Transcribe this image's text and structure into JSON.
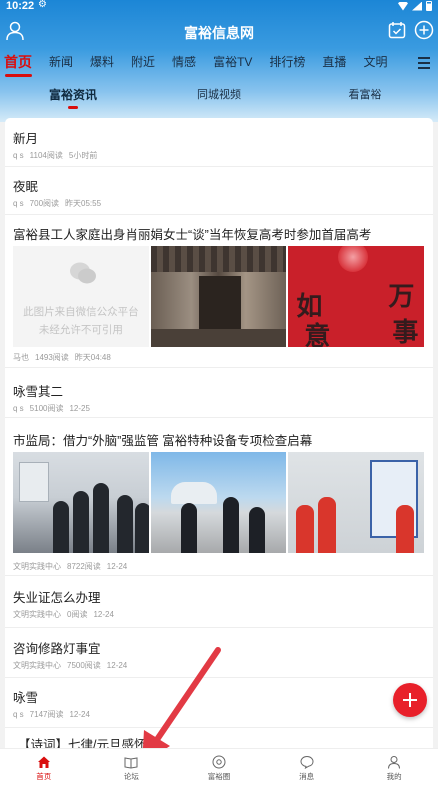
{
  "status_bar": {
    "time": "10:22"
  },
  "header": {
    "title": "富裕信息网"
  },
  "nav": {
    "tabs": [
      "首页",
      "新闻",
      "爆料",
      "附近",
      "情感",
      "富裕TV",
      "排行榜",
      "直播",
      "文明"
    ],
    "active_index": 0
  },
  "subtabs": {
    "items": [
      "富裕资讯",
      "同城视频",
      "看富裕"
    ],
    "active_index": 0
  },
  "feed": [
    {
      "title": "新月",
      "author": "q s",
      "reads": "1104阅读",
      "time": "5小时前"
    },
    {
      "title": "夜眠",
      "author": "q s",
      "reads": "700阅读",
      "time": "昨天05:55"
    },
    {
      "title": "富裕县工人家庭出身肖丽娟女士“谈”当年恢复高考时参加首届高考",
      "author": "马也",
      "reads": "1493阅读",
      "time": "昨天04:48",
      "placeholder_line1": "此图片来自微信公众平台",
      "placeholder_line2": "未经允许不可引用",
      "festive_chars": [
        "如",
        "意",
        "万",
        "事"
      ]
    },
    {
      "title": "咏雪其二",
      "author": "q s",
      "reads": "5100阅读",
      "time": "12-25"
    },
    {
      "title": "市监局：借力“外脑”强监管 富裕特种设备专项检查启幕",
      "author": "文明实践中心",
      "reads": "8722阅读",
      "time": "12-24"
    },
    {
      "title": "失业证怎么办理",
      "author": "文明实践中心",
      "reads": "0阅读",
      "time": "12-24"
    },
    {
      "title": "咨询修路灯事宜",
      "author": "文明实践中心",
      "reads": "7500阅读",
      "time": "12-24"
    },
    {
      "title": "咏雪",
      "author": "q s",
      "reads": "7147阅读",
      "time": "12-24"
    },
    {
      "title": "【诗词】七律/元旦感怀"
    }
  ],
  "bottom_nav": {
    "items": [
      "首页",
      "论坛",
      "富裕圈",
      "消息",
      "我的"
    ],
    "active_index": 0
  },
  "colors": {
    "accent": "#d90e0e",
    "header_blue": "#1c86d6",
    "fab": "#e8202a",
    "arrow": "#e23a44"
  }
}
